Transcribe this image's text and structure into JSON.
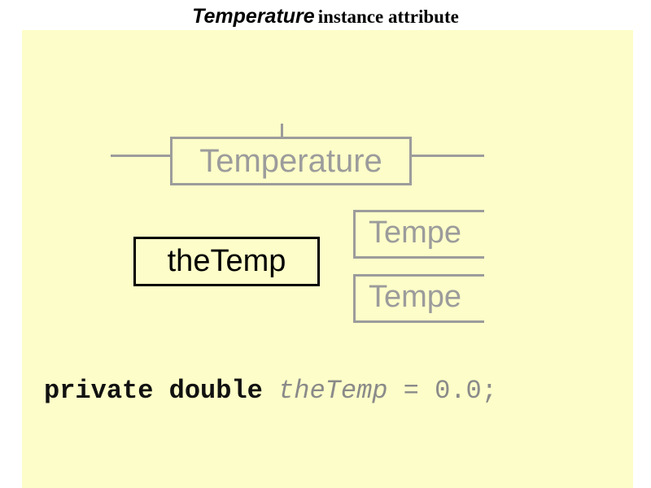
{
  "title": {
    "emphasis": "Temperature",
    "rest": "instance attribute"
  },
  "diagram": {
    "class_label": "Temperature",
    "object_label": "theTemp",
    "partial_labels": [
      "Tempe",
      "Tempe"
    ]
  },
  "code": {
    "keywords": "private double",
    "variable": "theTemp",
    "assignment": "= 0.0;"
  },
  "colors": {
    "background": "#fdfdc9",
    "ghost": "#9c9c9c",
    "emphasis": "#000000"
  }
}
